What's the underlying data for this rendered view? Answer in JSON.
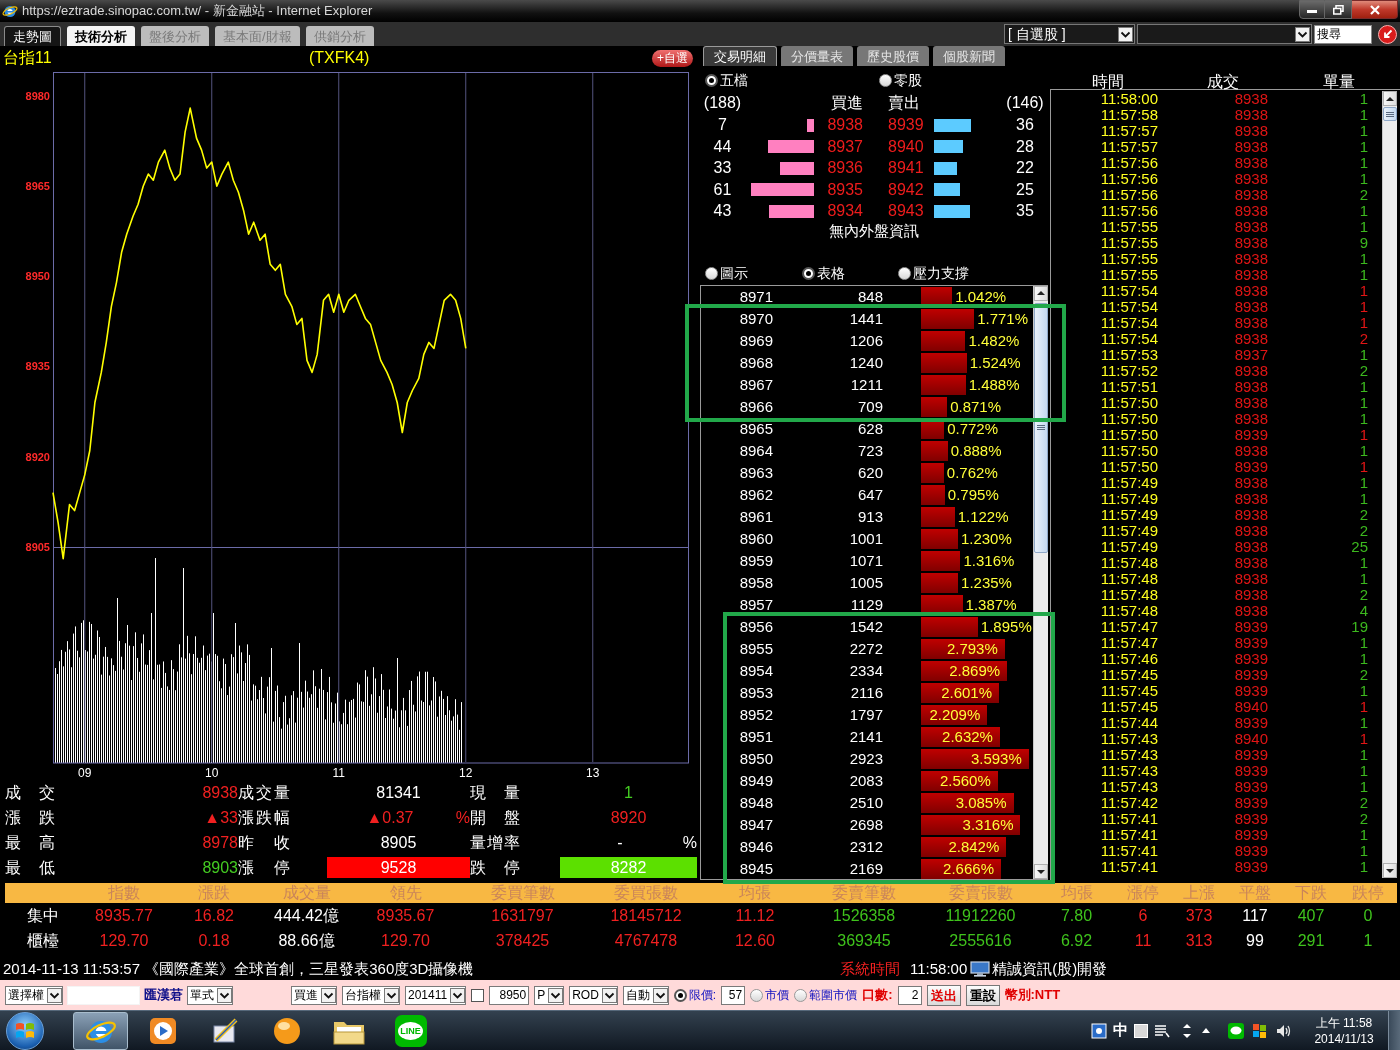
{
  "window": {
    "title": "https://eztrade.sinopac.com.tw/ - 新金融站 - Internet Explorer"
  },
  "nav_tabs": [
    {
      "label": "走勢圖",
      "selected": true,
      "highlighted": false
    },
    {
      "label": "技術分析",
      "selected": false,
      "highlighted": true
    },
    {
      "label": "盤後分析",
      "selected": false,
      "highlighted": false
    },
    {
      "label": "基本面/財報",
      "selected": false,
      "highlighted": false
    },
    {
      "label": "供銷分析",
      "selected": false,
      "highlighted": false
    }
  ],
  "toolbar": {
    "watchlist": "[ 自選股 ]",
    "search": "搜尋"
  },
  "chart_header": {
    "name": "台指11",
    "code": "(TXFK4)",
    "add_button": "+自選"
  },
  "chart": {
    "chart_data": {
      "type": "line",
      "x": [
        8.75,
        8.79,
        8.83,
        8.88,
        8.92,
        8.96,
        9.0,
        9.04,
        9.08,
        9.13,
        9.17,
        9.21,
        9.25,
        9.29,
        9.33,
        9.38,
        9.42,
        9.46,
        9.5,
        9.54,
        9.58,
        9.63,
        9.67,
        9.71,
        9.75,
        9.79,
        9.83,
        9.88,
        9.92,
        9.96,
        10.0,
        10.04,
        10.08,
        10.13,
        10.17,
        10.21,
        10.25,
        10.29,
        10.33,
        10.38,
        10.42,
        10.46,
        10.5,
        10.54,
        10.58,
        10.63,
        10.67,
        10.71,
        10.75,
        10.79,
        10.83,
        10.88,
        10.92,
        10.96,
        11.0,
        11.04,
        11.08,
        11.13,
        11.17,
        11.21,
        11.25,
        11.29,
        11.33,
        11.38,
        11.42,
        11.46,
        11.5,
        11.54,
        11.58,
        11.63,
        11.67,
        11.71,
        11.75,
        11.79,
        11.83,
        11.88,
        11.92,
        11.96,
        12.0
      ],
      "series": [
        {
          "color": "#ffff00",
          "values": [
            8914,
            8909,
            8903,
            8912,
            8911,
            8914,
            8917,
            8921,
            8929,
            8934,
            8939,
            8945,
            8949,
            8954,
            8957,
            8960,
            8962,
            8965,
            8967,
            8966,
            8969,
            8971,
            8968,
            8966,
            8967,
            8974,
            8978,
            8973,
            8971,
            8968,
            8969,
            8965,
            8967,
            8969,
            8966,
            8964,
            8961,
            8957,
            8959,
            8956,
            8957,
            8952,
            8951,
            8952,
            8947,
            8945,
            8942,
            8943,
            8936,
            8934,
            8937,
            8946,
            8947,
            8944,
            8947,
            8944,
            8946,
            8947,
            8945,
            8943,
            8942,
            8939,
            8936,
            8934,
            8932,
            8929,
            8924,
            8929,
            8931,
            8933,
            8937,
            8939,
            8938,
            8942,
            8946,
            8947,
            8946,
            8943,
            8938
          ]
        }
      ],
      "xlim": [
        8.75,
        13.75
      ],
      "ylim": [
        8869,
        8984
      ],
      "xticks": [
        {
          "value": 9,
          "label": "09"
        },
        10,
        11,
        12,
        13
      ],
      "yticks": [
        8905,
        8920,
        8935,
        8950,
        8965,
        8980
      ],
      "grid": true
    }
  },
  "quote_stats": [
    {
      "label": "成 交",
      "value": "8938",
      "kind": "plain",
      "color": "#f02020"
    },
    {
      "label": "成交量",
      "value": "81341",
      "kind": "plain",
      "color": "#ffffff"
    },
    {
      "label": "現 量",
      "value": "1",
      "kind": "plain",
      "color": "#44cc22"
    },
    {
      "label": "漲 跌",
      "value": "▲33",
      "kind": "plain",
      "color": "#f02020"
    },
    {
      "label": "漲跌幅",
      "value": "▲0.37",
      "unit": "%",
      "kind": "plain",
      "color": "#f02020"
    },
    {
      "label": "開 盤",
      "value": "8920",
      "kind": "plain",
      "color": "#f02020"
    },
    {
      "label": "最 高",
      "value": "8978",
      "kind": "plain",
      "color": "#f02020"
    },
    {
      "label": "昨 收",
      "value": "8905",
      "kind": "plain",
      "color": "#ffffff"
    },
    {
      "label": "量增率",
      "value": "-",
      "unit": "%",
      "kind": "plain",
      "color": "#ffffff"
    },
    {
      "label": "最 低",
      "value": "8903",
      "kind": "plain",
      "color": "#44cc22"
    },
    {
      "label": "漲 停",
      "value": "9528",
      "kind": "filled",
      "color": "#ff0000"
    },
    {
      "label": "跌 停",
      "value": "8282",
      "kind": "filled",
      "color": "#5ce000"
    }
  ],
  "panel_tabs": [
    {
      "label": "交易明細",
      "selected": true
    },
    {
      "label": "分價量表",
      "selected": false
    },
    {
      "label": "歷史股價",
      "selected": false
    },
    {
      "label": "個股新聞",
      "selected": false
    }
  ],
  "book_modes": [
    {
      "label": "五檔",
      "selected": true
    },
    {
      "label": "零股",
      "selected": false
    }
  ],
  "order_book": {
    "bid_total": "(188)",
    "bid_header": "買進",
    "ask_header": "賣出",
    "ask_total": "(146)",
    "levels": [
      {
        "bid": {
          "qty": "7",
          "price": "8938"
        },
        "ask": {
          "price": "8939",
          "qty": "36"
        }
      },
      {
        "bid": {
          "qty": "44",
          "price": "8937"
        },
        "ask": {
          "price": "8940",
          "qty": "28"
        }
      },
      {
        "bid": {
          "qty": "33",
          "price": "8936"
        },
        "ask": {
          "price": "8941",
          "qty": "22"
        }
      },
      {
        "bid": {
          "qty": "61",
          "price": "8935"
        },
        "ask": {
          "price": "8942",
          "qty": "25"
        }
      },
      {
        "bid": {
          "qty": "43",
          "price": "8934"
        },
        "ask": {
          "price": "8943",
          "qty": "35"
        }
      }
    ],
    "note": "無內外盤資訊"
  },
  "view_modes": [
    {
      "label": "圖示",
      "selected": false
    },
    {
      "label": "表格",
      "selected": true
    },
    {
      "label": "壓力支撐",
      "selected": false
    }
  ],
  "price_volume": [
    {
      "highlighted": false,
      "rows": [
        {
          "price": "8971",
          "volume": "848",
          "percent": "1.042%"
        }
      ]
    },
    {
      "highlighted": true,
      "rows": [
        {
          "price": "8970",
          "volume": "1441",
          "percent": "1.771%"
        },
        {
          "price": "8969",
          "volume": "1206",
          "percent": "1.482%"
        },
        {
          "price": "8968",
          "volume": "1240",
          "percent": "1.524%"
        },
        {
          "price": "8967",
          "volume": "1211",
          "percent": "1.488%"
        },
        {
          "price": "8966",
          "volume": "709",
          "percent": "0.871%"
        }
      ]
    },
    {
      "highlighted": false,
      "rows": [
        {
          "price": "8965",
          "volume": "628",
          "percent": "0.772%"
        },
        {
          "price": "8964",
          "volume": "723",
          "percent": "0.888%"
        },
        {
          "price": "8963",
          "volume": "620",
          "percent": "0.762%"
        },
        {
          "price": "8962",
          "volume": "647",
          "percent": "0.795%"
        },
        {
          "price": "8961",
          "volume": "913",
          "percent": "1.122%"
        },
        {
          "price": "8960",
          "volume": "1001",
          "percent": "1.230%"
        },
        {
          "price": "8959",
          "volume": "1071",
          "percent": "1.316%"
        },
        {
          "price": "8958",
          "volume": "1005",
          "percent": "1.235%"
        },
        {
          "price": "8957",
          "volume": "1129",
          "percent": "1.387%"
        }
      ]
    },
    {
      "highlighted": true,
      "rows": [
        {
          "price": "8956",
          "volume": "1542",
          "percent": "1.895%"
        },
        {
          "price": "8955",
          "volume": "2272",
          "percent": "2.793%"
        },
        {
          "price": "8954",
          "volume": "2334",
          "percent": "2.869%"
        },
        {
          "price": "8953",
          "volume": "2116",
          "percent": "2.601%"
        },
        {
          "price": "8952",
          "volume": "1797",
          "percent": "2.209%"
        },
        {
          "price": "8951",
          "volume": "2141",
          "percent": "2.632%"
        },
        {
          "price": "8950",
          "volume": "2923",
          "percent": "3.593%"
        },
        {
          "price": "8949",
          "volume": "2083",
          "percent": "2.560%"
        },
        {
          "price": "8948",
          "volume": "2510",
          "percent": "3.085%"
        },
        {
          "price": "8947",
          "volume": "2698",
          "percent": "3.316%"
        },
        {
          "price": "8946",
          "volume": "2312",
          "percent": "2.842%"
        },
        {
          "price": "8945",
          "volume": "2169",
          "percent": "2.666%"
        }
      ]
    }
  ],
  "trades": {
    "columns": [
      "時間",
      "成交",
      "單量"
    ],
    "rows": [
      {
        "time": "11:58:00",
        "price": "8938",
        "qty": "1",
        "color": "#3cb81e"
      },
      {
        "time": "11:57:58",
        "price": "8938",
        "qty": "1",
        "color": "#3cb81e"
      },
      {
        "time": "11:57:57",
        "price": "8938",
        "qty": "1",
        "color": "#3cb81e"
      },
      {
        "time": "11:57:57",
        "price": "8938",
        "qty": "1",
        "color": "#3cb81e"
      },
      {
        "time": "11:57:56",
        "price": "8938",
        "qty": "1",
        "color": "#3cb81e"
      },
      {
        "time": "11:57:56",
        "price": "8938",
        "qty": "1",
        "color": "#3cb81e"
      },
      {
        "time": "11:57:56",
        "price": "8938",
        "qty": "2",
        "color": "#3cb81e"
      },
      {
        "time": "11:57:56",
        "price": "8938",
        "qty": "1",
        "color": "#3cb81e"
      },
      {
        "time": "11:57:55",
        "price": "8938",
        "qty": "1",
        "color": "#3cb81e"
      },
      {
        "time": "11:57:55",
        "price": "8938",
        "qty": "9",
        "color": "#3cb81e"
      },
      {
        "time": "11:57:55",
        "price": "8938",
        "qty": "1",
        "color": "#3cb81e"
      },
      {
        "time": "11:57:55",
        "price": "8938",
        "qty": "1",
        "color": "#3cb81e"
      },
      {
        "time": "11:57:54",
        "price": "8938",
        "qty": "1",
        "color": "#e01515"
      },
      {
        "time": "11:57:54",
        "price": "8938",
        "qty": "1",
        "color": "#e01515"
      },
      {
        "time": "11:57:54",
        "price": "8938",
        "qty": "1",
        "color": "#e01515"
      },
      {
        "time": "11:57:54",
        "price": "8938",
        "qty": "2",
        "color": "#e01515"
      },
      {
        "time": "11:57:53",
        "price": "8937",
        "qty": "1",
        "color": "#3cb81e"
      },
      {
        "time": "11:57:52",
        "price": "8938",
        "qty": "2",
        "color": "#3cb81e"
      },
      {
        "time": "11:57:51",
        "price": "8938",
        "qty": "1",
        "color": "#3cb81e"
      },
      {
        "time": "11:57:50",
        "price": "8938",
        "qty": "1",
        "color": "#3cb81e"
      },
      {
        "time": "11:57:50",
        "price": "8938",
        "qty": "1",
        "color": "#3cb81e"
      },
      {
        "time": "11:57:50",
        "price": "8939",
        "qty": "1",
        "color": "#e01515"
      },
      {
        "time": "11:57:50",
        "price": "8938",
        "qty": "1",
        "color": "#3cb81e"
      },
      {
        "time": "11:57:50",
        "price": "8939",
        "qty": "1",
        "color": "#e01515"
      },
      {
        "time": "11:57:49",
        "price": "8938",
        "qty": "1",
        "color": "#3cb81e"
      },
      {
        "time": "11:57:49",
        "price": "8938",
        "qty": "1",
        "color": "#3cb81e"
      },
      {
        "time": "11:57:49",
        "price": "8938",
        "qty": "2",
        "color": "#3cb81e"
      },
      {
        "time": "11:57:49",
        "price": "8938",
        "qty": "2",
        "color": "#3cb81e"
      },
      {
        "time": "11:57:49",
        "price": "8938",
        "qty": "25",
        "color": "#3cb81e"
      },
      {
        "time": "11:57:48",
        "price": "8938",
        "qty": "1",
        "color": "#3cb81e"
      },
      {
        "time": "11:57:48",
        "price": "8938",
        "qty": "1",
        "color": "#3cb81e"
      },
      {
        "time": "11:57:48",
        "price": "8938",
        "qty": "2",
        "color": "#3cb81e"
      },
      {
        "time": "11:57:48",
        "price": "8938",
        "qty": "4",
        "color": "#3cb81e"
      },
      {
        "time": "11:57:47",
        "price": "8939",
        "qty": "19",
        "color": "#3cb81e"
      },
      {
        "time": "11:57:47",
        "price": "8939",
        "qty": "1",
        "color": "#3cb81e"
      },
      {
        "time": "11:57:46",
        "price": "8939",
        "qty": "1",
        "color": "#3cb81e"
      },
      {
        "time": "11:57:45",
        "price": "8939",
        "qty": "2",
        "color": "#3cb81e"
      },
      {
        "time": "11:57:45",
        "price": "8939",
        "qty": "1",
        "color": "#3cb81e"
      },
      {
        "time": "11:57:45",
        "price": "8940",
        "qty": "1",
        "color": "#e01515"
      },
      {
        "time": "11:57:44",
        "price": "8939",
        "qty": "1",
        "color": "#3cb81e"
      },
      {
        "time": "11:57:43",
        "price": "8940",
        "qty": "1",
        "color": "#e01515"
      },
      {
        "time": "11:57:43",
        "price": "8939",
        "qty": "1",
        "color": "#3cb81e"
      },
      {
        "time": "11:57:43",
        "price": "8939",
        "qty": "1",
        "color": "#3cb81e"
      },
      {
        "time": "11:57:43",
        "price": "8939",
        "qty": "1",
        "color": "#3cb81e"
      },
      {
        "time": "11:57:42",
        "price": "8939",
        "qty": "2",
        "color": "#3cb81e"
      },
      {
        "time": "11:57:41",
        "price": "8939",
        "qty": "2",
        "color": "#3cb81e"
      },
      {
        "time": "11:57:41",
        "price": "8939",
        "qty": "1",
        "color": "#3cb81e"
      },
      {
        "time": "11:57:41",
        "price": "8939",
        "qty": "1",
        "color": "#3cb81e"
      },
      {
        "time": "11:57:41",
        "price": "8939",
        "qty": "1",
        "color": "#3cb81e"
      }
    ]
  },
  "index_table": {
    "columns": [
      "指數",
      "漲跌",
      "成交量",
      "領先",
      "委買筆數",
      "委買張數",
      "均張",
      "委賣筆數",
      "委賣張數",
      "均張",
      "漲停",
      "上漲",
      "平盤",
      "下跌",
      "跌停"
    ],
    "rows": [
      {
        "label": "集中",
        "cells": [
          {
            "text": "8935.77",
            "color": "#f02020"
          },
          {
            "text": "16.82",
            "color": "#f02020"
          },
          {
            "text": "444.42億",
            "color": "#ffffff"
          },
          {
            "text": "8935.67",
            "color": "#f02020"
          },
          {
            "text": "1631797",
            "color": "#f02020"
          },
          {
            "text": "18145712",
            "color": "#f02020"
          },
          {
            "text": "11.12",
            "color": "#f02020"
          },
          {
            "text": "1526358",
            "color": "#3fc31c"
          },
          {
            "text": "11912260",
            "color": "#3fc31c"
          },
          {
            "text": "7.80",
            "color": "#3fc31c"
          },
          {
            "text": "6",
            "color": "#f02020"
          },
          {
            "text": "373",
            "color": "#f02020"
          },
          {
            "text": "117",
            "color": "#ffffff"
          },
          {
            "text": "407",
            "color": "#3fc31c"
          },
          {
            "text": "0",
            "color": "#3fc31c"
          }
        ]
      },
      {
        "label": "櫃檯",
        "cells": [
          {
            "text": "129.70",
            "color": "#f02020"
          },
          {
            "text": "0.18",
            "color": "#f02020"
          },
          {
            "text": "88.66億",
            "color": "#ffffff"
          },
          {
            "text": "129.70",
            "color": "#f02020"
          },
          {
            "text": "378425",
            "color": "#f02020"
          },
          {
            "text": "4767478",
            "color": "#f02020"
          },
          {
            "text": "12.60",
            "color": "#f02020"
          },
          {
            "text": "369345",
            "color": "#3fc31c"
          },
          {
            "text": "2555616",
            "color": "#3fc31c"
          },
          {
            "text": "6.92",
            "color": "#3fc31c"
          },
          {
            "text": "11",
            "color": "#f02020"
          },
          {
            "text": "313",
            "color": "#f02020"
          },
          {
            "text": "99",
            "color": "#ffffff"
          },
          {
            "text": "291",
            "color": "#3fc31c"
          },
          {
            "text": "1",
            "color": "#3fc31c"
          }
        ]
      }
    ]
  },
  "news": {
    "text": "2014-11-13 11:53:57 《國際產業》全球首創，三星發表360度3D攝像機",
    "clock_label": "系統時間",
    "clock": "11:58:00",
    "vendor": "精誠資訊(股)開發"
  },
  "order_bar": {
    "account": [
      {
        "kind": "select",
        "value": "選擇權"
      },
      {
        "kind": "input"
      },
      {
        "kind": "text",
        "text": "匯漢莙",
        "color": "#10108a"
      },
      {
        "kind": "select",
        "value": "單式"
      }
    ],
    "order": [
      {
        "kind": "select",
        "value": "買進"
      },
      {
        "kind": "select",
        "value": "台指權"
      },
      {
        "kind": "select",
        "value": "201411"
      },
      {
        "kind": "checkbox",
        "checked": false
      },
      {
        "kind": "input",
        "value": "8950"
      },
      {
        "kind": "select",
        "value": "P"
      },
      {
        "kind": "select",
        "value": "ROD"
      },
      {
        "kind": "select",
        "value": "自動"
      },
      {
        "kind": "radio",
        "selected": true,
        "label": "限價:"
      },
      {
        "kind": "input",
        "value": "57"
      },
      {
        "kind": "radio",
        "selected": false,
        "label": "市價"
      },
      {
        "kind": "radio",
        "selected": false,
        "label": "範圍市價"
      },
      {
        "kind": "text",
        "text": "口數:",
        "color": "#e00000"
      },
      {
        "kind": "input",
        "value": "2"
      },
      {
        "kind": "button",
        "label": "送出",
        "color": "#e00000"
      },
      {
        "kind": "button",
        "label": "重設",
        "color": "#000000"
      },
      {
        "kind": "text",
        "text": "幣別:NTT",
        "color": "#e00000"
      }
    ]
  },
  "taskbar": {
    "apps": [
      {
        "kind": "browser",
        "active": true
      },
      {
        "kind": "media",
        "active": false
      },
      {
        "kind": "tool",
        "active": false
      },
      {
        "kind": "ball",
        "active": false
      },
      {
        "kind": "folder",
        "active": false
      },
      {
        "kind": "chat",
        "active": false,
        "label": "LINE"
      }
    ],
    "ime": "中",
    "time": "上午 11:58",
    "date": "2014/11/13"
  }
}
